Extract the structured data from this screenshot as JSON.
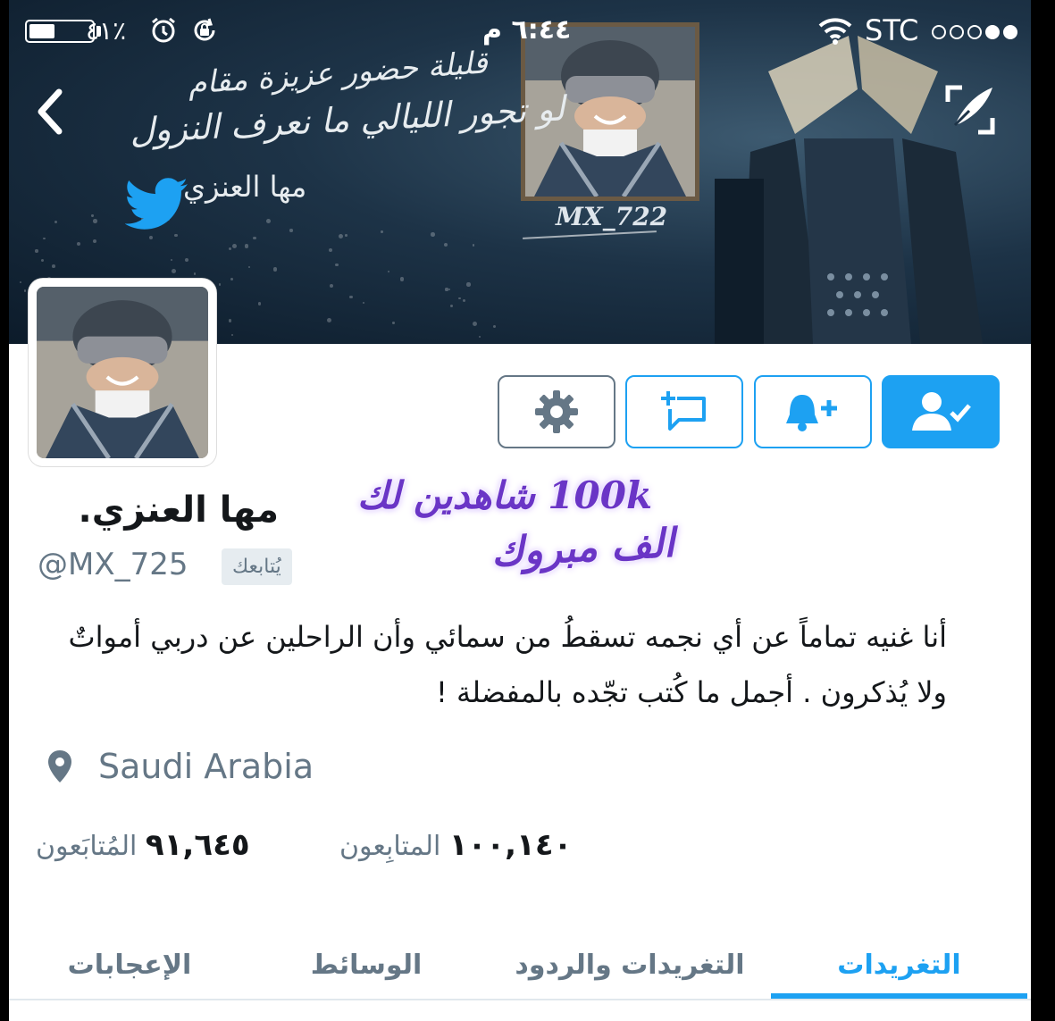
{
  "status_bar": {
    "battery_text": "٤١٪",
    "battery_level": 0.41,
    "clock": "٦:٤٤ م",
    "carrier": "STC",
    "signal_bars": [
      false,
      false,
      false,
      true,
      true
    ]
  },
  "banner": {
    "poem_line_1": "قليلة حضور عزيزة مقام",
    "poem_line_2": "لو تجور الليالي ما نعرف النزول",
    "name": "مها العنزي",
    "signature": "MX_722"
  },
  "sticker": {
    "line_1": "100k شاهدين لك",
    "line_2": "الف مبروك"
  },
  "profile": {
    "display_name": "مها العنزي.",
    "handle": "@MX_725",
    "follows_you": "يُتابعك",
    "bio": "أنا غنيه تماماً عن أي نجمه تسقطُ من سمائي وأن الراحلين عن دربي أمواتٌ ولا يُذكرون . أجمل ما كُتب تجّده بالمفضلة !",
    "location": "Saudi Arabia"
  },
  "stats": {
    "following_count": "١٠٠,١٤٠",
    "following_label": "المتابِعون",
    "followers_count": "٩١,٦٤٥",
    "followers_label": "المُتابَعون"
  },
  "tabs": {
    "tweets": "التغريدات",
    "tweets_replies": "التغريدات والردود",
    "media": "الوسائط",
    "likes": "الإعجابات",
    "active": "tweets"
  },
  "colors": {
    "accent": "#1da1f2",
    "muted": "#657786",
    "text": "#14171a",
    "sticker": "#6a35c6"
  },
  "icons": {
    "back": "chevron-left-icon",
    "edit": "quill-edit-icon",
    "settings": "gear-icon",
    "message": "message-plus-icon",
    "notify": "bell-plus-icon",
    "following": "user-check-icon",
    "location": "map-pin-icon"
  }
}
